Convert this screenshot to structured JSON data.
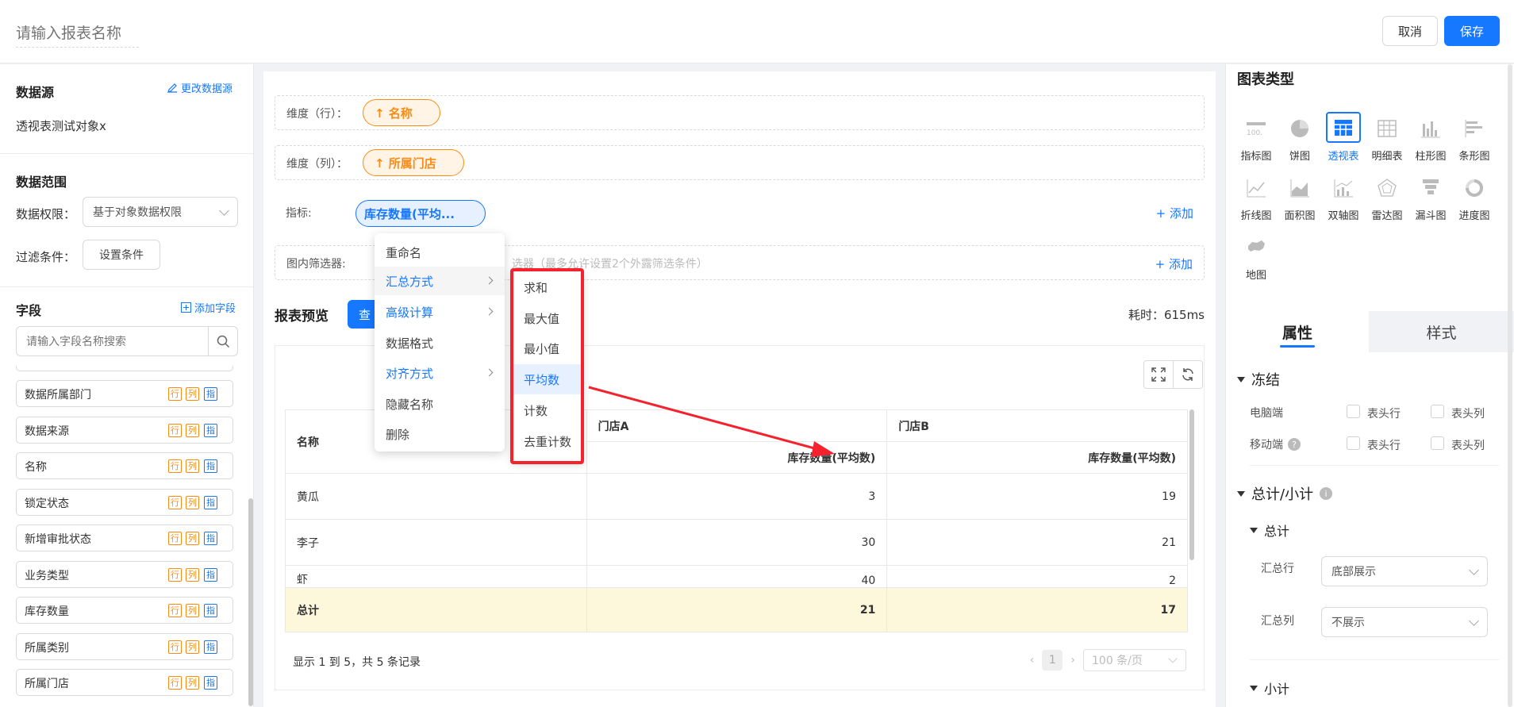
{
  "header": {
    "report_name_placeholder": "请输入报表名称",
    "cancel_label": "取消",
    "save_label": "保存"
  },
  "left": {
    "datasource_title": "数据源",
    "change_datasource": "更改数据源",
    "datasource_name": "透视表测试对象x",
    "range_title": "数据范围",
    "permission_label": "数据权限：",
    "permission_value": "基于对象数据权限",
    "filter_label": "过滤条件：",
    "filter_button": "设置条件",
    "fields_title": "字段",
    "add_field": "添加字段",
    "search_placeholder": "请输入字段名称搜索",
    "tag_row": "行",
    "tag_col": "列",
    "tag_ind": "指",
    "fields": [
      "数据所属部门",
      "数据来源",
      "名称",
      "锁定状态",
      "新增审批状态",
      "业务类型",
      "库存数量",
      "所属类别",
      "所属门店"
    ]
  },
  "center": {
    "dim_row_label": "维度（行）：",
    "dim_row_pill": "↑ 名称",
    "dim_col_label": "维度（列）：",
    "dim_col_pill": "↑ 所属门店",
    "metric_label": "指标:",
    "metric_pill": "库存数量(平均...",
    "filter_label": "图内筛选器:",
    "filter_hint": "选器（最多允许设置2个外露筛选条件）",
    "add_label": "+ 添加",
    "preview_title": "报表预览",
    "query_btn": "查",
    "elapsed": "耗时：615ms",
    "table": {
      "row_header": "名称",
      "stores": [
        "门店A",
        "门店B"
      ],
      "metric": "库存数量(平均数)",
      "rows": [
        {
          "name": "黄瓜",
          "a": "3",
          "b": "19"
        },
        {
          "name": "李子",
          "a": "30",
          "b": "21"
        },
        {
          "name": "虾",
          "a": "40",
          "b": "2"
        }
      ],
      "total": {
        "name": "总计",
        "a": "21",
        "b": "17"
      }
    },
    "pager_info": "显示 1 到 5，共 5 条记录",
    "page": "1",
    "page_size": "100 条/页"
  },
  "menu": {
    "items": [
      "重命名",
      "汇总方式",
      "高级计算",
      "数据格式",
      "对齐方式",
      "隐藏名称",
      "删除"
    ],
    "submenu": [
      "求和",
      "最大值",
      "最小值",
      "平均数",
      "计数",
      "去重计数"
    ]
  },
  "right": {
    "chart_type_title": "图表类型",
    "chart_types": [
      "指标图",
      "饼图",
      "透视表",
      "明细表",
      "柱形图",
      "条形图",
      "折线图",
      "面积图",
      "双轴图",
      "雷达图",
      "漏斗图",
      "进度图",
      "地图"
    ],
    "tab_props": "属性",
    "tab_style": "样式",
    "freeze_title": "冻结",
    "pc_label": "电脑端",
    "mobile_label": "移动端",
    "header_row": "表头行",
    "header_col": "表头列",
    "total_sub_title": "总计/小计",
    "total_title": "总计",
    "total_row_label": "汇总行",
    "total_row_value": "底部展示",
    "total_col_label": "汇总列",
    "total_col_value": "不展示",
    "subtotal_title": "小计"
  },
  "colors": {
    "primary": "#1677ff",
    "orange": "#fa8c16",
    "highlight_red": "#f5222d",
    "total_row_bg": "#fdf7dc"
  }
}
